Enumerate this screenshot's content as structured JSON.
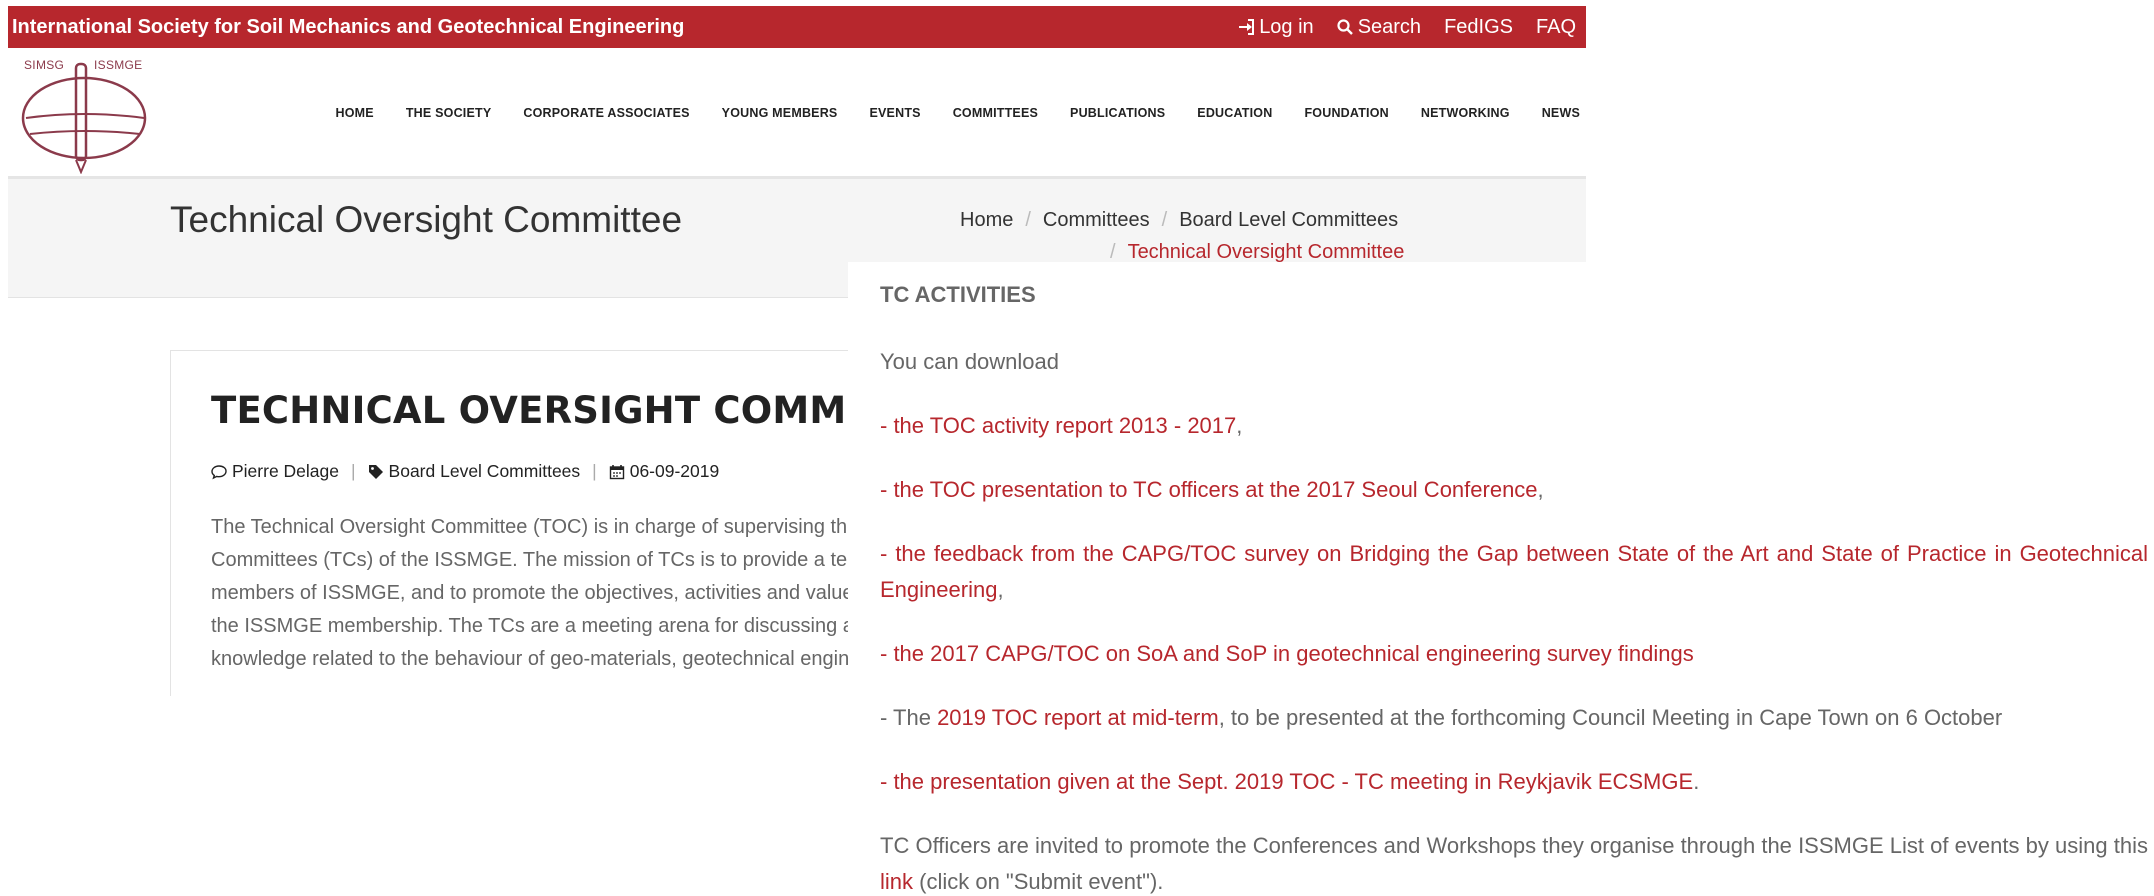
{
  "topbar": {
    "brand": "International Society for Soil Mechanics and Geotechnical Engineering",
    "links": [
      {
        "label": "Log in",
        "icon": "sign-in-icon"
      },
      {
        "label": "Search",
        "icon": "search-icon"
      },
      {
        "label": "FedIGS"
      },
      {
        "label": "FAQ"
      }
    ],
    "color": "#b7272d"
  },
  "logo": {
    "left_text": "SIMSG",
    "right_text": "ISSMGE"
  },
  "menu": [
    "HOME",
    "THE SOCIETY",
    "CORPORATE ASSOCIATES",
    "YOUNG MEMBERS",
    "EVENTS",
    "COMMITTEES",
    "PUBLICATIONS",
    "EDUCATION",
    "FOUNDATION",
    "NETWORKING",
    "NEWS"
  ],
  "page_title": "Technical Oversight Committee",
  "breadcrumb": [
    "Home",
    "Committees",
    "Board Level Committees",
    "Technical Oversight Committee"
  ],
  "article": {
    "heading": "TECHNICAL OVERSIGHT COMMITTEE",
    "author": "Pierre Delage",
    "category": "Board Level Committees",
    "date": "06-09-2019",
    "intro_lines": [
      "The Technical Oversight Committee (TOC) is in charge of supervising the Technical",
      "Committees (TCs) of the ISSMGE. The mission of TCs is to provide a technical forum for",
      "members of ISSMGE, and to promote the objectives, activities and values of the Society to",
      "the ISSMGE membership. The TCs are a meeting arena for discussing and disseminating",
      "knowledge related to the behaviour of geo-materials, geotechnical engineering and practice."
    ]
  },
  "panel": {
    "heading": "TC ACTIVITIES",
    "download_intro": "You can download",
    "items": [
      {
        "link": "- the TOC activity report 2013 - 2017",
        "after": ","
      },
      {
        "link": "- the TOC presentation to TC officers at the 2017 Seoul Conference",
        "after": ","
      },
      {
        "link": "- the feedback from the CAPG/TOC survey on Bridging the Gap between State of the Art and State of Practice in Geotechnical Engineering",
        "after": ","
      },
      {
        "link": "- the 2017 CAPG/TOC on SoA and SoP in geotechnical engineering survey findings",
        "after": ""
      }
    ],
    "midterm": {
      "before": "- The ",
      "link": "2019 TOC report at mid-term",
      "after": ", to be presented at the forthcoming Council Meeting in Cape Town on 6 October"
    },
    "reykjavik": {
      "link": "- the presentation given at the Sept. 2019 TOC - TC meeting in Reykjavik ECSMGE",
      "after": "."
    },
    "officers": {
      "before": "TC Officers are invited to promote the Conferences and Workshops they organise through the ISSMGE List of events by using this ",
      "link": "link",
      "after": " (click on \"Submit event\")."
    },
    "link_color": "#b7272d"
  }
}
